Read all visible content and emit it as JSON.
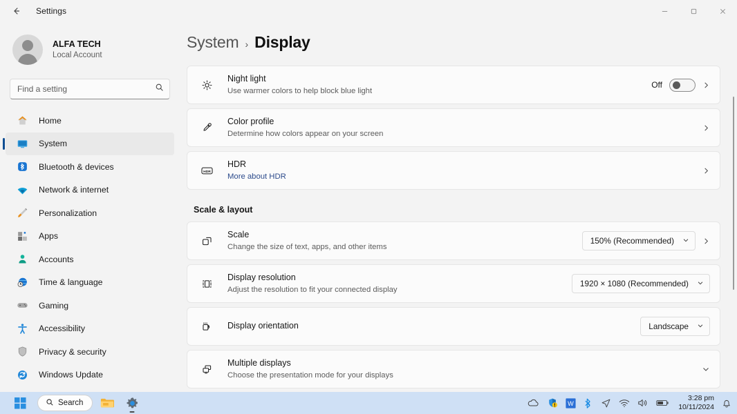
{
  "window": {
    "title": "Settings",
    "back_label": "back-arrow",
    "minimize_label": "Minimize",
    "maximize_label": "Restore",
    "close_label": "Close"
  },
  "account": {
    "name": "ALFA TECH",
    "type": "Local Account"
  },
  "search": {
    "placeholder": "Find a setting",
    "value": ""
  },
  "sidebar": {
    "items": [
      {
        "label": "Home",
        "icon": "home-icon",
        "active": false
      },
      {
        "label": "System",
        "icon": "monitor-icon",
        "active": true
      },
      {
        "label": "Bluetooth & devices",
        "icon": "bluetooth-icon",
        "active": false
      },
      {
        "label": "Network & internet",
        "icon": "wifi-icon",
        "active": false
      },
      {
        "label": "Personalization",
        "icon": "brush-icon",
        "active": false
      },
      {
        "label": "Apps",
        "icon": "apps-icon",
        "active": false
      },
      {
        "label": "Accounts",
        "icon": "person-icon",
        "active": false
      },
      {
        "label": "Time & language",
        "icon": "clock-globe-icon",
        "active": false
      },
      {
        "label": "Gaming",
        "icon": "gamepad-icon",
        "active": false
      },
      {
        "label": "Accessibility",
        "icon": "accessibility-icon",
        "active": false
      },
      {
        "label": "Privacy & security",
        "icon": "shield-icon",
        "active": false
      },
      {
        "label": "Windows Update",
        "icon": "update-icon",
        "active": false
      }
    ]
  },
  "breadcrumb": {
    "parent": "System",
    "separator": "›",
    "current": "Display"
  },
  "main": {
    "cards_top": [
      {
        "title": "Night light",
        "subtitle": "Use warmer colors to help block blue light",
        "icon": "brightness-icon",
        "control": "toggle",
        "toggle_label": "Off",
        "toggle_on": false,
        "has_chevron": true
      },
      {
        "title": "Color profile",
        "subtitle": "Determine how colors appear on your screen",
        "icon": "eyedropper-icon",
        "control": "none",
        "has_chevron": true
      },
      {
        "title": "HDR",
        "subtitle": "More about HDR",
        "subtitle_is_link": true,
        "icon": "hdr-icon",
        "control": "none",
        "has_chevron": true
      }
    ],
    "section_title": "Scale & layout",
    "cards_layout": [
      {
        "title": "Scale",
        "subtitle": "Change the size of text, apps, and other items",
        "icon": "scale-icon",
        "control": "dropdown",
        "dropdown_value": "150% (Recommended)",
        "has_chevron": true
      },
      {
        "title": "Display resolution",
        "subtitle": "Adjust the resolution to fit your connected display",
        "icon": "resolution-icon",
        "control": "dropdown",
        "dropdown_value": "1920 × 1080 (Recommended)",
        "has_chevron": false
      },
      {
        "title": "Display orientation",
        "subtitle": "",
        "icon": "orientation-icon",
        "control": "dropdown",
        "dropdown_value": "Landscape",
        "has_chevron": false
      },
      {
        "title": "Multiple displays",
        "subtitle": "Choose the presentation mode for your displays",
        "icon": "multiple-displays-icon",
        "control": "expand",
        "has_chevron": false
      }
    ]
  },
  "taskbar": {
    "start_label": "Start",
    "search_label": "Search",
    "apps": [
      {
        "name": "file-explorer-icon",
        "active": false
      },
      {
        "name": "settings-gear-icon",
        "active": true
      }
    ],
    "tray": [
      "onedrive-icon",
      "defender-shield-icon",
      "w-app-icon",
      "bluetooth-icon",
      "send-icon",
      "wifi-icon",
      "speaker-icon",
      "battery-icon"
    ],
    "time": "3:28 pm",
    "date": "10/11/2024",
    "notification_icon": "bell-icon"
  },
  "colors": {
    "accent": "#0f4d92",
    "taskbar": "#cfe0f5",
    "page_bg": "#f3f3f3",
    "card_bg": "#fbfbfb",
    "link": "#2b4a8b"
  }
}
